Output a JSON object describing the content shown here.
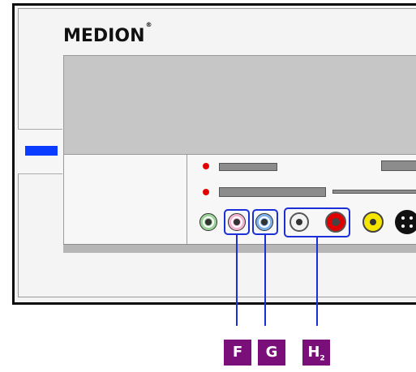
{
  "brand": {
    "name": "MEDION",
    "mark": "®"
  },
  "callouts": {
    "f": {
      "letter": "F"
    },
    "g": {
      "letter": "G"
    },
    "h": {
      "letter": "H",
      "sub": "2"
    }
  },
  "colors": {
    "led": "#0a3cff",
    "callout_box": "#1a2fd8",
    "label_bg": "#7a0f7a",
    "jack_green": "#9ad39a",
    "jack_pink": "#f4b3d2",
    "jack_blue": "#7fb2ea",
    "jack_white": "#ffffff",
    "jack_red": "#e00000",
    "jack_yellow": "#f5e500"
  },
  "icons": [
    "led-indicator",
    "audio-jack",
    "svideo-port",
    "callout-leader"
  ]
}
